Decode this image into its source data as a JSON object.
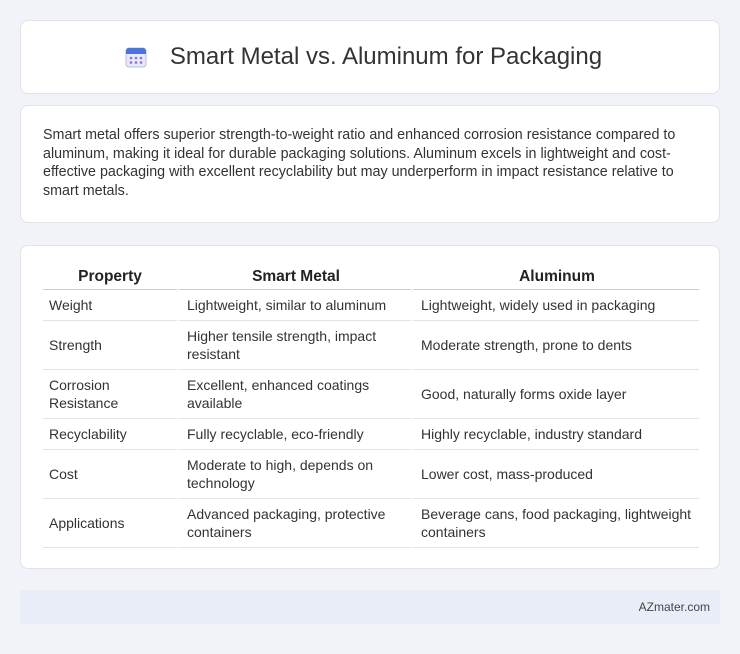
{
  "header": {
    "title": "Smart Metal vs. Aluminum for Packaging",
    "icon": "calendar-icon"
  },
  "summary": {
    "text": "Smart metal offers superior strength-to-weight ratio and enhanced corrosion resistance compared to aluminum, making it ideal for durable packaging solutions. Aluminum excels in lightweight and cost-effective packaging with excellent recyclability but may underperform in impact resistance relative to smart metals."
  },
  "table": {
    "headers": [
      "Property",
      "Smart Metal",
      "Aluminum"
    ],
    "rows": [
      [
        "Weight",
        "Lightweight, similar to aluminum",
        "Lightweight, widely used in packaging"
      ],
      [
        "Strength",
        "Higher tensile strength, impact resistant",
        "Moderate strength, prone to dents"
      ],
      [
        "Corrosion Resistance",
        "Excellent, enhanced coatings available",
        "Good, naturally forms oxide layer"
      ],
      [
        "Recyclability",
        "Fully recyclable, eco-friendly",
        "Highly recyclable, industry standard"
      ],
      [
        "Cost",
        "Moderate to high, depends on technology",
        "Lower cost, mass-produced"
      ],
      [
        "Applications",
        "Advanced packaging, protective containers",
        "Beverage cans, food packaging, lightweight containers"
      ]
    ]
  },
  "footer": {
    "text": "AZmater.com"
  },
  "colors": {
    "background": "#f1f3f8",
    "card": "#ffffff",
    "footer": "#e8edf7"
  }
}
